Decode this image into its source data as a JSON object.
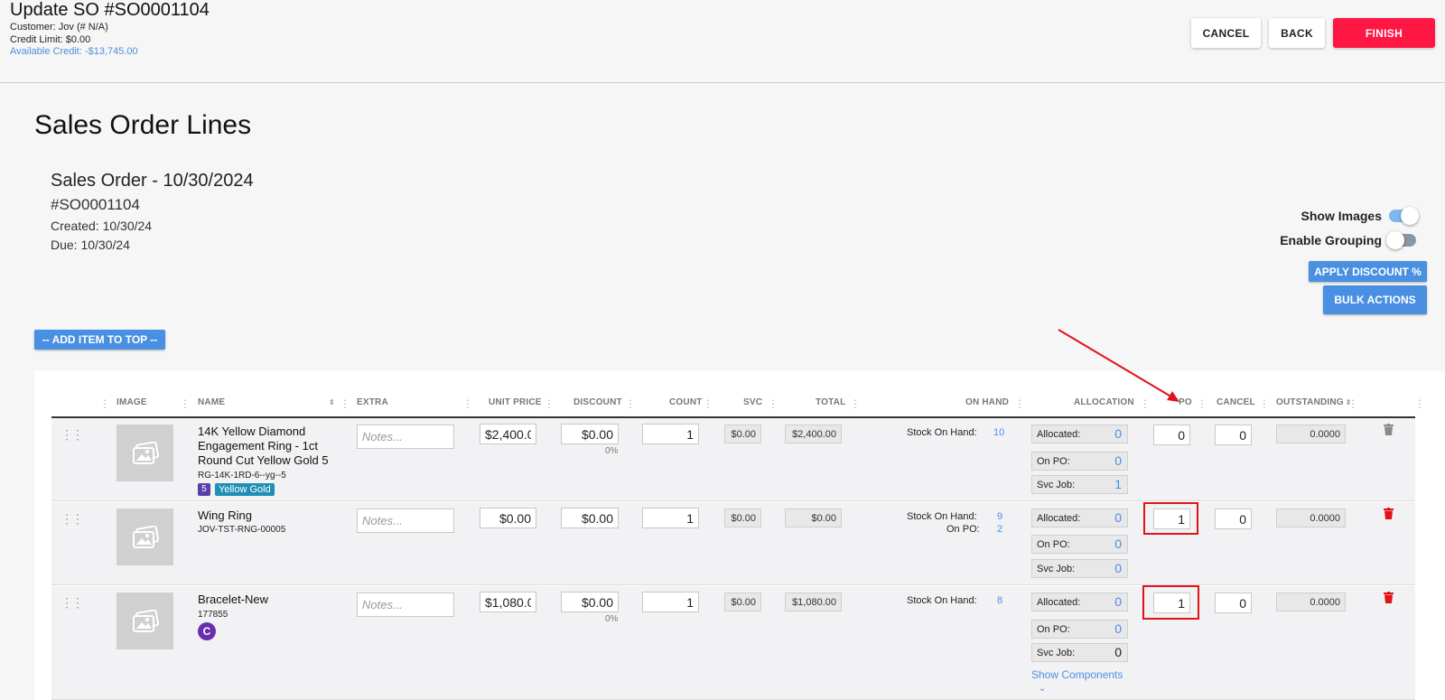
{
  "header": {
    "title": "Update SO #SO0001104",
    "customer": "Customer: Jov (# N/A)",
    "credit_limit": "Credit Limit: $0.00",
    "available_credit": "Available Credit: -$13,745.00",
    "cancel_label": "CANCEL",
    "back_label": "BACK",
    "finish_label": "FINISH"
  },
  "page": {
    "title": "Sales Order Lines",
    "order_heading": "Sales Order - 10/30/2024",
    "order_number": "#SO0001104",
    "created": "Created: 10/30/24",
    "due": "Due: 10/30/24"
  },
  "controls": {
    "show_images_label": "Show Images",
    "show_images_on": true,
    "enable_grouping_label": "Enable Grouping",
    "enable_grouping_on": false,
    "apply_discount_label": "APPLY DISCOUNT %",
    "bulk_actions_label": "BULK ACTIONS",
    "add_item_label": "-- ADD ITEM TO TOP --"
  },
  "table": {
    "columns": [
      "IMAGE",
      "NAME",
      "EXTRA",
      "UNIT PRICE",
      "DISCOUNT",
      "COUNT",
      "SVC",
      "TOTAL",
      "ON HAND",
      "ALLOCATION",
      "PO",
      "CANCEL",
      "OUTSTANDING"
    ],
    "notes_placeholder": "Notes...",
    "rows": [
      {
        "name": "14K Yellow Diamond Engagement Ring - 1ct Round Cut Yellow Gold 5",
        "sku": "RG-14K-1RD-6--yg--5",
        "badge_num": "5",
        "badge_tag": "Yellow Gold",
        "unit_price": "$2,400.0",
        "discount": "$0.00",
        "discount_pct": "0%",
        "count": "1",
        "svc": "$0.00",
        "total": "$2,400.00",
        "stock_on_hand_label": "Stock On Hand:",
        "stock_on_hand": "10",
        "allocated_label": "Allocated:",
        "allocated": "0",
        "on_po_label": "On PO:",
        "on_po": "0",
        "svc_job_label": "Svc Job:",
        "svc_job": "1",
        "po": "0",
        "cancel": "0",
        "outstanding": "0.0000"
      },
      {
        "name": "Wing Ring",
        "sku": "JOV-TST-RNG-00005",
        "unit_price": "$0.00",
        "discount": "$0.00",
        "count": "1",
        "svc": "$0.00",
        "total": "$0.00",
        "stock_on_hand_label": "Stock On Hand:",
        "stock_on_hand": "9",
        "on_po_stock_label": "On PO:",
        "on_po_stock": "2",
        "allocated_label": "Allocated:",
        "allocated": "0",
        "on_po_label": "On PO:",
        "on_po": "0",
        "svc_job_label": "Svc Job:",
        "svc_job": "0",
        "po": "1",
        "cancel": "0",
        "outstanding": "0.0000"
      },
      {
        "name": "Bracelet-New",
        "sku": "177855",
        "badge_c": "C",
        "unit_price": "$1,080.0",
        "discount": "$0.00",
        "discount_pct": "0%",
        "count": "1",
        "svc": "$0.00",
        "total": "$1,080.00",
        "stock_on_hand_label": "Stock On Hand:",
        "stock_on_hand": "8",
        "allocated_label": "Allocated:",
        "allocated": "0",
        "on_po_label": "On PO:",
        "on_po": "0",
        "svc_job_label": "Svc Job:",
        "svc_job": "0",
        "po": "1",
        "cancel": "0",
        "outstanding": "0.0000",
        "show_components_label": "Show Components"
      }
    ]
  },
  "colors": {
    "accent": "#4a90e2",
    "finish": "#ff1744",
    "highlight": "#e0131a",
    "delete": "#e0131a"
  }
}
